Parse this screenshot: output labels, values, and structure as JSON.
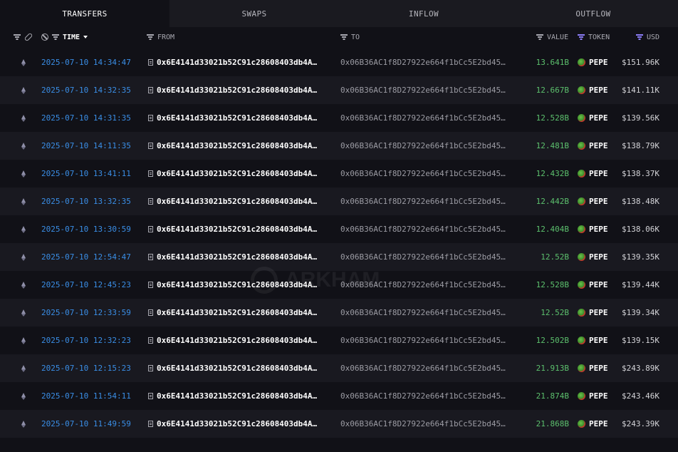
{
  "tabs": [
    {
      "label": "TRANSFERS",
      "active": true
    },
    {
      "label": "SWAPS",
      "active": false
    },
    {
      "label": "INFLOW",
      "active": false
    },
    {
      "label": "OUTFLOW",
      "active": false
    }
  ],
  "columns": {
    "time": "TIME",
    "from": "FROM",
    "to": "TO",
    "value": "VALUE",
    "token": "TOKEN",
    "usd": "USD"
  },
  "watermark": "ARKHAM",
  "icons": {
    "chain": "ethereum-icon",
    "token": "pepe-token-icon",
    "from": "contract-icon"
  },
  "colors": {
    "time": "#3a8ee6",
    "value": "#5cc06d",
    "accent": "#8b7cf6"
  },
  "rows": [
    {
      "time": "2025-07-10 14:34:47",
      "from": "0x6E4141d33021b52C91c28608403db4A…",
      "to": "0x06B36AC1f8D27922e664f1bCc5E2bd45…",
      "value": "13.641B",
      "token": "PEPE",
      "usd": "$151.96K"
    },
    {
      "time": "2025-07-10 14:32:35",
      "from": "0x6E4141d33021b52C91c28608403db4A…",
      "to": "0x06B36AC1f8D27922e664f1bCc5E2bd45…",
      "value": "12.667B",
      "token": "PEPE",
      "usd": "$141.11K"
    },
    {
      "time": "2025-07-10 14:31:35",
      "from": "0x6E4141d33021b52C91c28608403db4A…",
      "to": "0x06B36AC1f8D27922e664f1bCc5E2bd45…",
      "value": "12.528B",
      "token": "PEPE",
      "usd": "$139.56K"
    },
    {
      "time": "2025-07-10 14:11:35",
      "from": "0x6E4141d33021b52C91c28608403db4A…",
      "to": "0x06B36AC1f8D27922e664f1bCc5E2bd45…",
      "value": "12.481B",
      "token": "PEPE",
      "usd": "$138.79K"
    },
    {
      "time": "2025-07-10 13:41:11",
      "from": "0x6E4141d33021b52C91c28608403db4A…",
      "to": "0x06B36AC1f8D27922e664f1bCc5E2bd45…",
      "value": "12.432B",
      "token": "PEPE",
      "usd": "$138.37K"
    },
    {
      "time": "2025-07-10 13:32:35",
      "from": "0x6E4141d33021b52C91c28608403db4A…",
      "to": "0x06B36AC1f8D27922e664f1bCc5E2bd45…",
      "value": "12.442B",
      "token": "PEPE",
      "usd": "$138.48K"
    },
    {
      "time": "2025-07-10 13:30:59",
      "from": "0x6E4141d33021b52C91c28608403db4A…",
      "to": "0x06B36AC1f8D27922e664f1bCc5E2bd45…",
      "value": "12.404B",
      "token": "PEPE",
      "usd": "$138.06K"
    },
    {
      "time": "2025-07-10 12:54:47",
      "from": "0x6E4141d33021b52C91c28608403db4A…",
      "to": "0x06B36AC1f8D27922e664f1bCc5E2bd45…",
      "value": "12.52B",
      "token": "PEPE",
      "usd": "$139.35K"
    },
    {
      "time": "2025-07-10 12:45:23",
      "from": "0x6E4141d33021b52C91c28608403db4A…",
      "to": "0x06B36AC1f8D27922e664f1bCc5E2bd45…",
      "value": "12.528B",
      "token": "PEPE",
      "usd": "$139.44K"
    },
    {
      "time": "2025-07-10 12:33:59",
      "from": "0x6E4141d33021b52C91c28608403db4A…",
      "to": "0x06B36AC1f8D27922e664f1bCc5E2bd45…",
      "value": "12.52B",
      "token": "PEPE",
      "usd": "$139.34K"
    },
    {
      "time": "2025-07-10 12:32:23",
      "from": "0x6E4141d33021b52C91c28608403db4A…",
      "to": "0x06B36AC1f8D27922e664f1bCc5E2bd45…",
      "value": "12.502B",
      "token": "PEPE",
      "usd": "$139.15K"
    },
    {
      "time": "2025-07-10 12:15:23",
      "from": "0x6E4141d33021b52C91c28608403db4A…",
      "to": "0x06B36AC1f8D27922e664f1bCc5E2bd45…",
      "value": "21.913B",
      "token": "PEPE",
      "usd": "$243.89K"
    },
    {
      "time": "2025-07-10 11:54:11",
      "from": "0x6E4141d33021b52C91c28608403db4A…",
      "to": "0x06B36AC1f8D27922e664f1bCc5E2bd45…",
      "value": "21.874B",
      "token": "PEPE",
      "usd": "$243.46K"
    },
    {
      "time": "2025-07-10 11:49:59",
      "from": "0x6E4141d33021b52C91c28608403db4A…",
      "to": "0x06B36AC1f8D27922e664f1bCc5E2bd45…",
      "value": "21.868B",
      "token": "PEPE",
      "usd": "$243.39K"
    }
  ]
}
